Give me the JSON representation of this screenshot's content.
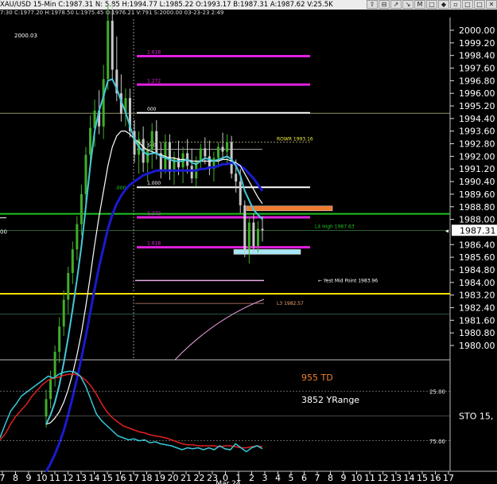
{
  "titlebar": {
    "text": "XAU/USD 15-Min  C:1987.31  N:  5.85  H:1994.77  L:1985.22  O:1993.17  B:1987.31  A:1987.62  V:25.5K",
    "buttons": [
      "⇧",
      "⊟",
      "↗",
      "↘",
      "M",
      "□",
      "◆",
      "▫",
      "□",
      "□",
      "✕"
    ]
  },
  "infobar": {
    "text": "7:30  C:1977.20  H:1978.50  L:1975.45  O:1976.21  V:791  S:2000.00  03-23-23  2:49"
  },
  "colors": {
    "bg": "#000000",
    "up": "#3fae2a",
    "down": "#c8c8c8",
    "ma_fast": "#46c8d8",
    "ma_slow": "#1a1ad0",
    "ma_white": "#ffffff",
    "magenta": "#e020e0",
    "yellow": "#f0e000",
    "green_line": "#20c020",
    "orange_box": "#f07a30",
    "cyan_box": "#a6e6f6",
    "pink": "#e8a0e0",
    "stoch_k": "#36c8d8",
    "stoch_d": "#e02020"
  },
  "main": {
    "top_left_label": "2000.03",
    "price_axis": [
      "2000.00",
      "1999.20",
      "1998.40",
      "1997.60",
      "1996.80",
      "1996.00",
      "1995.20",
      "1994.40",
      "1993.60",
      "1992.80",
      "1992.00",
      "1991.20",
      "1990.40",
      "1989.60",
      "1988.80",
      "1988.00",
      "1987.31",
      "1986.40",
      "1985.60",
      "1984.80",
      "1984.00",
      "1983.20",
      "1982.40",
      "1981.60",
      "1980.80",
      "1980.00"
    ],
    "left_stub_label": "00",
    "fib_labels": [
      "1.618",
      "1.272",
      "000",
      "500",
      "1.000",
      "1.272",
      "1.618"
    ],
    "green_small_label": ".000",
    "rowr_label": "ROWR 1993.16",
    "l4_label": "L4 High 1987.63",
    "yest_mid_label": "← Yest Mid Point 1983.96",
    "l3_label": "L3 1982.57",
    "current_price": "1987.31"
  },
  "indicator": {
    "td_label": "955 TD",
    "yrange_label": "3852 YRange",
    "axis_labels": [
      "25.00",
      "75.00"
    ],
    "sto_label": "STO  15,"
  },
  "x_axis": {
    "labels": [
      "7",
      "8",
      "9",
      "10",
      "11",
      "12",
      "13",
      "14",
      "15",
      "16",
      "17",
      "18",
      "19",
      "20",
      "21",
      "22",
      "23",
      "0",
      "1",
      "2",
      "3",
      "4",
      "5",
      "6",
      "7",
      "8",
      "9",
      "10",
      "11",
      "12",
      "13",
      "14",
      "15",
      "16",
      "17"
    ],
    "sub_label": "Mar 24"
  },
  "chart_data": {
    "type": "candlestick",
    "y_axis_range": [
      1979.4,
      2000.6
    ],
    "stochastic_range": [
      0,
      100
    ],
    "ohlc": [
      {
        "o": 1975.5,
        "h": 1977.2,
        "l": 1974.8,
        "c": 1976.6
      },
      {
        "o": 1976.6,
        "h": 1978.4,
        "l": 1976.0,
        "c": 1977.9
      },
      {
        "o": 1977.9,
        "h": 1980.0,
        "l": 1977.4,
        "c": 1979.6
      },
      {
        "o": 1979.6,
        "h": 1981.8,
        "l": 1978.9,
        "c": 1981.2
      },
      {
        "o": 1981.2,
        "h": 1983.5,
        "l": 1980.6,
        "c": 1982.9
      },
      {
        "o": 1982.9,
        "h": 1985.0,
        "l": 1982.0,
        "c": 1984.6
      },
      {
        "o": 1984.6,
        "h": 1986.6,
        "l": 1983.9,
        "c": 1986.1
      },
      {
        "o": 1986.1,
        "h": 1988.2,
        "l": 1985.4,
        "c": 1987.7
      },
      {
        "o": 1987.7,
        "h": 1990.2,
        "l": 1987.0,
        "c": 1989.6
      },
      {
        "o": 1989.6,
        "h": 1992.6,
        "l": 1989.0,
        "c": 1992.1
      },
      {
        "o": 1992.1,
        "h": 1994.6,
        "l": 1991.2,
        "c": 1993.8
      },
      {
        "o": 1993.8,
        "h": 1995.6,
        "l": 1992.6,
        "c": 1994.9
      },
      {
        "o": 1994.9,
        "h": 1996.2,
        "l": 1993.4,
        "c": 1993.9
      },
      {
        "o": 1993.9,
        "h": 1997.8,
        "l": 1993.1,
        "c": 1996.9
      },
      {
        "o": 1996.9,
        "h": 2001.6,
        "l": 1996.2,
        "c": 2000.6
      },
      {
        "o": 2000.6,
        "h": 2001.7,
        "l": 1996.8,
        "c": 1997.5
      },
      {
        "o": 1997.5,
        "h": 1999.6,
        "l": 1995.5,
        "c": 1996.0
      },
      {
        "o": 1996.0,
        "h": 1997.2,
        "l": 1994.2,
        "c": 1994.7
      },
      {
        "o": 1994.7,
        "h": 1996.3,
        "l": 1993.9,
        "c": 1995.7
      },
      {
        "o": 1995.7,
        "h": 1996.3,
        "l": 1993.2,
        "c": 1993.6
      },
      {
        "o": 1993.6,
        "h": 1994.3,
        "l": 1991.6,
        "c": 1992.1
      },
      {
        "o": 1992.1,
        "h": 1993.6,
        "l": 1990.9,
        "c": 1993.1
      },
      {
        "o": 1993.1,
        "h": 1993.9,
        "l": 1991.0,
        "c": 1991.6
      },
      {
        "o": 1991.6,
        "h": 1992.7,
        "l": 1990.4,
        "c": 1992.4
      },
      {
        "o": 1992.4,
        "h": 1994.1,
        "l": 1991.2,
        "c": 1993.6
      },
      {
        "o": 1993.6,
        "h": 1994.3,
        "l": 1991.8,
        "c": 1992.2
      },
      {
        "o": 1992.2,
        "h": 1992.9,
        "l": 1990.6,
        "c": 1991.1
      },
      {
        "o": 1991.1,
        "h": 1993.4,
        "l": 1990.9,
        "c": 1992.9
      },
      {
        "o": 1992.9,
        "h": 1993.4,
        "l": 1990.5,
        "c": 1991.0
      },
      {
        "o": 1991.0,
        "h": 1992.3,
        "l": 1990.2,
        "c": 1991.9
      },
      {
        "o": 1991.9,
        "h": 1993.0,
        "l": 1990.8,
        "c": 1991.3
      },
      {
        "o": 1991.3,
        "h": 1992.6,
        "l": 1990.3,
        "c": 1992.2
      },
      {
        "o": 1992.2,
        "h": 1993.1,
        "l": 1990.9,
        "c": 1991.4
      },
      {
        "o": 1991.4,
        "h": 1992.5,
        "l": 1990.3,
        "c": 1990.6
      },
      {
        "o": 1990.6,
        "h": 1992.0,
        "l": 1990.1,
        "c": 1991.7
      },
      {
        "o": 1991.7,
        "h": 1992.8,
        "l": 1991.2,
        "c": 1992.5
      },
      {
        "o": 1992.5,
        "h": 1993.2,
        "l": 1991.5,
        "c": 1992.0
      },
      {
        "o": 1992.0,
        "h": 1993.0,
        "l": 1990.8,
        "c": 1991.2
      },
      {
        "o": 1991.2,
        "h": 1992.3,
        "l": 1990.4,
        "c": 1991.9
      },
      {
        "o": 1991.9,
        "h": 1992.9,
        "l": 1991.3,
        "c": 1992.6
      },
      {
        "o": 1992.6,
        "h": 1993.5,
        "l": 1991.8,
        "c": 1992.3
      },
      {
        "o": 1992.3,
        "h": 1993.4,
        "l": 1991.5,
        "c": 1992.9
      },
      {
        "o": 1992.9,
        "h": 1993.3,
        "l": 1990.6,
        "c": 1990.9
      },
      {
        "o": 1990.9,
        "h": 1991.8,
        "l": 1989.7,
        "c": 1990.4
      },
      {
        "o": 1990.4,
        "h": 1991.2,
        "l": 1988.4,
        "c": 1988.9
      },
      {
        "o": 1988.9,
        "h": 1989.2,
        "l": 1985.6,
        "c": 1986.1
      },
      {
        "o": 1986.1,
        "h": 1988.2,
        "l": 1985.2,
        "c": 1987.8
      },
      {
        "o": 1987.8,
        "h": 1988.4,
        "l": 1985.8,
        "c": 1986.3
      },
      {
        "o": 1986.3,
        "h": 1987.9,
        "l": 1985.9,
        "c": 1987.4
      },
      {
        "o": 1987.4,
        "h": 1988.2,
        "l": 1986.6,
        "c": 1987.3
      }
    ],
    "ma_fast": [
      1975.0,
      1975.6,
      1976.4,
      1977.5,
      1978.9,
      1980.5,
      1982.3,
      1984.2,
      1986.3,
      1988.8,
      1991.4,
      1993.6,
      1994.9,
      1995.8,
      1996.8,
      1996.9,
      1996.3,
      1995.5,
      1994.8,
      1993.9,
      1993.1,
      1992.6,
      1992.3,
      1992.1,
      1992.2,
      1992.2,
      1992.0,
      1991.9,
      1991.8,
      1991.7,
      1991.7,
      1991.7,
      1991.8,
      1991.6,
      1991.5,
      1991.7,
      1991.9,
      1991.8,
      1991.7,
      1991.8,
      1991.9,
      1992.0,
      1991.8,
      1991.4,
      1990.8,
      1989.8,
      1989.2,
      1988.6,
      1988.3,
      1988.0
    ],
    "ma_white": [
      1975.0,
      1975.1,
      1975.4,
      1975.8,
      1976.4,
      1977.2,
      1978.2,
      1979.4,
      1980.8,
      1982.5,
      1984.4,
      1986.4,
      1988.2,
      1989.8,
      1991.4,
      1992.6,
      1993.3,
      1993.6,
      1993.6,
      1993.4,
      1993.1,
      1992.9,
      1992.6,
      1992.4,
      1992.3,
      1992.2,
      1992.1,
      1992.0,
      1991.9,
      1991.9,
      1991.8,
      1991.8,
      1991.8,
      1991.7,
      1991.7,
      1991.7,
      1991.7,
      1991.7,
      1991.7,
      1991.7,
      1991.8,
      1991.8,
      1991.7,
      1991.6,
      1991.4,
      1990.9,
      1990.4,
      1989.9,
      1989.4,
      1989.0
    ],
    "ma_slow": [
      1972.0,
      1972.5,
      1973.1,
      1973.8,
      1974.6,
      1975.6,
      1976.7,
      1977.9,
      1979.2,
      1980.6,
      1982.1,
      1983.6,
      1985.0,
      1986.2,
      1987.4,
      1988.3,
      1989.0,
      1989.5,
      1989.9,
      1990.2,
      1990.4,
      1990.6,
      1990.8,
      1990.9,
      1991.0,
      1991.1,
      1991.1,
      1991.1,
      1991.1,
      1991.1,
      1991.1,
      1991.1,
      1991.1,
      1991.1,
      1991.1,
      1991.2,
      1991.2,
      1991.3,
      1991.3,
      1991.4,
      1991.5,
      1991.5,
      1991.6,
      1991.5,
      1991.4,
      1991.2,
      1990.9,
      1990.6,
      1990.2,
      1989.8
    ],
    "levels": [
      {
        "name": "green",
        "price": 1988.35
      },
      {
        "name": "yellow",
        "price": 1983.28
      },
      {
        "name": "yest_mid",
        "price": 1984.12
      },
      {
        "name": "l3",
        "price": 1982.67
      }
    ],
    "fib_levels": [
      1998.36,
      1996.55,
      1994.76,
      1992.44,
      1990.04,
      1988.13,
      1986.23
    ],
    "boxes": [
      {
        "name": "orange",
        "price_top": 1988.85,
        "price_bottom": 1988.58
      },
      {
        "name": "cyan",
        "price_top": 1986.09,
        "price_bottom": 1985.79
      }
    ],
    "stoch_k": [
      72,
      58,
      45,
      38,
      30,
      26,
      22,
      18,
      14,
      10,
      12,
      8,
      6,
      5,
      6,
      10,
      20,
      34,
      48,
      55,
      60,
      65,
      70,
      72,
      74,
      73,
      75,
      74,
      77,
      76,
      78,
      79,
      80,
      82,
      84,
      82,
      83,
      82,
      84,
      82,
      84,
      80,
      83,
      84,
      78,
      82,
      86,
      82,
      80,
      83
    ],
    "stoch_d": [
      74,
      68,
      58,
      50,
      44,
      38,
      30,
      24,
      18,
      14,
      12,
      11,
      9,
      8,
      8,
      10,
      14,
      20,
      28,
      38,
      46,
      52,
      56,
      60,
      62,
      64,
      66,
      67,
      69,
      70,
      71,
      72,
      74,
      76,
      78,
      79,
      79,
      80,
      80,
      80,
      80,
      81,
      80,
      80,
      81,
      82,
      82,
      81,
      80,
      81
    ]
  }
}
